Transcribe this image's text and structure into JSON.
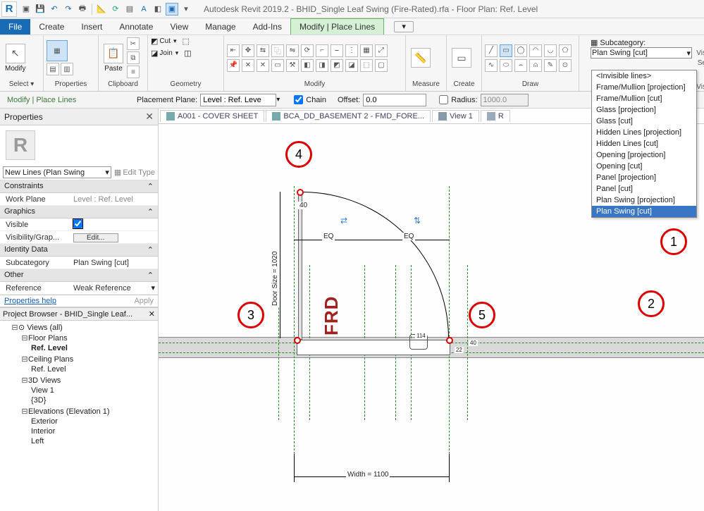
{
  "app": {
    "title": "Autodesk Revit 2019.2 - BHID_Single Leaf Swing (Fire-Rated).rfa - Floor Plan: Ref. Level"
  },
  "menu": {
    "file": "File",
    "items": [
      "Create",
      "Insert",
      "Annotate",
      "View",
      "Manage",
      "Add-Ins"
    ],
    "context": "Modify | Place Lines"
  },
  "ribbon": {
    "select": "Select ▾",
    "modify": "Modify",
    "properties": "Properties",
    "clipboard": "Clipboard",
    "paste": "Paste",
    "cut": "Cut",
    "join": "Join",
    "geometry": "Geometry",
    "modify_panel": "Modify",
    "measure": "Measure",
    "create": "Create",
    "draw": "Draw",
    "subcategory_label": "Subcategory:",
    "subcategory_value": "Plan Swing [cut]",
    "side": {
      "vis": "Vis",
      "se": "Se",
      "vis2": "Vis"
    },
    "subcategory_options": [
      "<Invisible lines>",
      "Frame/Mullion [projection]",
      "Frame/Mullion [cut]",
      "Glass [projection]",
      "Glass [cut]",
      "Hidden Lines [projection]",
      "Hidden Lines [cut]",
      "Opening [projection]",
      "Opening [cut]",
      "Panel [projection]",
      "Panel [cut]",
      "Plan Swing [projection]",
      "Plan Swing [cut]"
    ]
  },
  "optbar": {
    "context": "Modify | Place Lines",
    "placement_label": "Placement Plane:",
    "placement_value": "Level : Ref. Leve",
    "chain": "Chain",
    "offset_label": "Offset:",
    "offset_value": "0.0",
    "radius_label": "Radius:",
    "radius_value": "1000.0"
  },
  "properties": {
    "title": "Properties",
    "type_sel": "New Lines (Plan Swing",
    "edit_type": "Edit Type",
    "sections": {
      "constraints": "Constraints",
      "graphics": "Graphics",
      "identity": "Identity Data",
      "other": "Other"
    },
    "rows": {
      "work_plane": {
        "k": "Work Plane",
        "v": "Level : Ref. Level"
      },
      "visible": {
        "k": "Visible",
        "checked": true
      },
      "vis_grap": {
        "k": "Visibility/Grap...",
        "btn": "Edit..."
      },
      "subcat": {
        "k": "Subcategory",
        "v": "Plan Swing [cut]"
      },
      "reference": {
        "k": "Reference",
        "v": "Weak Reference"
      }
    },
    "help": "Properties help",
    "apply": "Apply"
  },
  "browser": {
    "title": "Project Browser - BHID_Single Leaf...",
    "views_all": "Views (all)",
    "floor_plans": "Floor Plans",
    "ref_level": "Ref. Level",
    "ceiling_plans": "Ceiling Plans",
    "ref_level2": "Ref. Level",
    "three_d": "3D Views",
    "view1": "View 1",
    "threed": "{3D}",
    "elev": "Elevations (Elevation 1)",
    "ext": "Exterior",
    "int": "Interior",
    "left": "Left"
  },
  "viewtabs": [
    {
      "label": "A001 - COVER SHEET"
    },
    {
      "label": "BCA_DD_BASEMENT 2 - FMD_FORE..."
    },
    {
      "label": "View 1"
    },
    {
      "label": "R"
    }
  ],
  "drawing": {
    "frd": "FRD",
    "eq1": "EQ",
    "eq2": "EQ",
    "door_size": "Door Size = 1020",
    "width": "Width = 1100",
    "d40a": "40",
    "d40b": "40",
    "d22": "22",
    "d114": "114"
  },
  "callouts": {
    "c1": "1",
    "c2": "2",
    "c3": "3",
    "c4": "4",
    "c5": "5"
  }
}
